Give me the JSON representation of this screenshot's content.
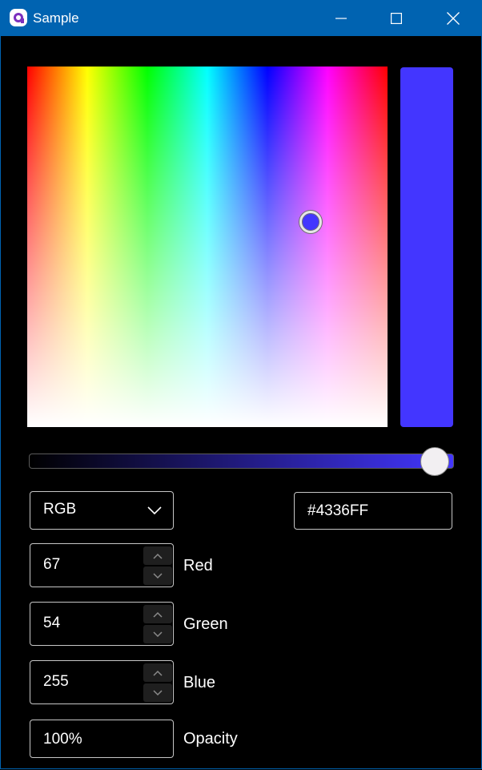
{
  "window": {
    "title": "Sample",
    "icon": "app-logo-icon",
    "controls": [
      "minimize-icon",
      "maximize-icon",
      "close-icon"
    ]
  },
  "color_picker": {
    "selected_color": "#4336FF",
    "hex_value": "#4336FF",
    "mode": "RGB",
    "channels": {
      "red": {
        "value": "67",
        "label": "Red"
      },
      "green": {
        "value": "54",
        "label": "Green"
      },
      "blue": {
        "value": "255",
        "label": "Blue"
      }
    },
    "opacity": {
      "value": "100%",
      "label": "Opacity"
    },
    "value_slider_level": 1.0
  },
  "colors": {
    "title_bar": "#0063B1",
    "background": "#000000",
    "selected": "#4336FF",
    "thumb": "#F2EFF2"
  }
}
